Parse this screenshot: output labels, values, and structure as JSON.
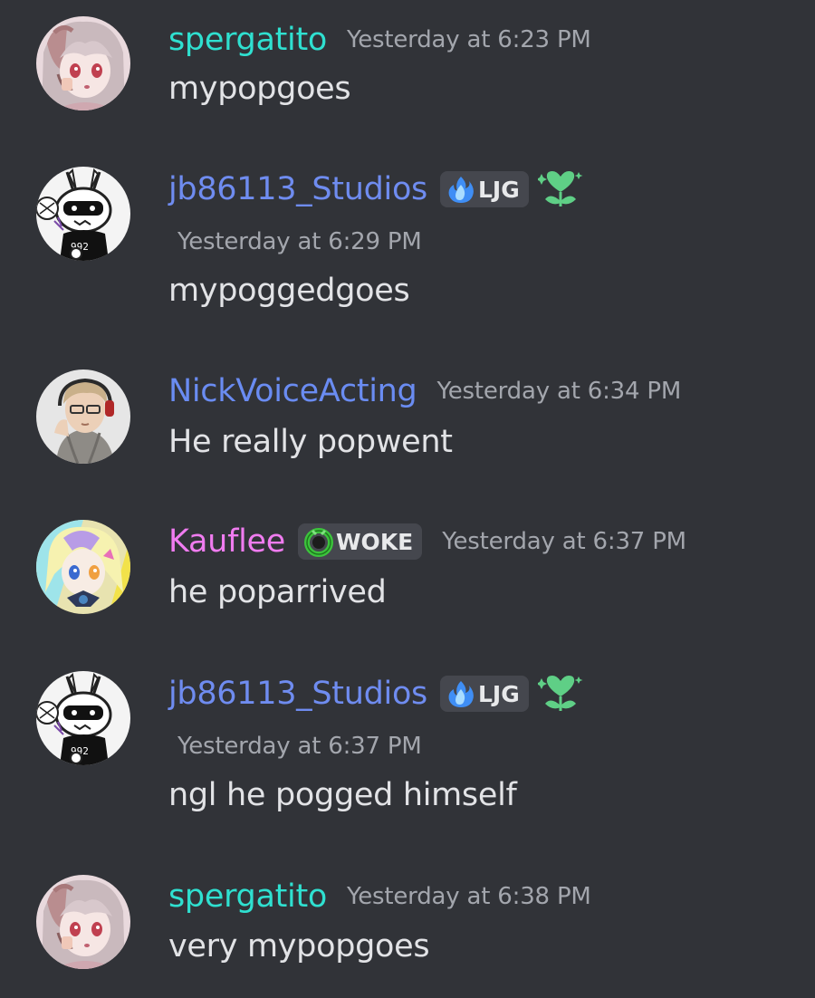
{
  "colors": {
    "background": "#313338",
    "spergatito": "#2fe0d0",
    "jb86113_Studios": "#6f8cf0",
    "NickVoiceActing": "#6a8cf2",
    "Kauflee": "#f07cf0",
    "timestamp": "#a3a6ad",
    "tag_background": "#45474e",
    "role_icon": "#5fcf86"
  },
  "messages": [
    {
      "author": "spergatito",
      "timestamp": "Yesterday at 6:23 PM",
      "content": "mypopgoes",
      "avatar_icon": "anime-girl-avatar-icon"
    },
    {
      "author": "jb86113_Studios",
      "tag": "LJG",
      "tag_icon": "blue-flame-icon",
      "role_icon": "heart-flower-icon",
      "timestamp": "Yesterday at 6:29 PM",
      "content": "mypoggedgoes",
      "avatar_icon": "sketch-character-avatar-icon"
    },
    {
      "author": "NickVoiceActing",
      "timestamp": "Yesterday at 6:34 PM",
      "content": "He really popwent",
      "avatar_icon": "headphones-character-avatar-icon"
    },
    {
      "author": "Kauflee",
      "tag": "WOKE",
      "tag_icon": "green-ring-icon",
      "timestamp": "Yesterday at 6:37 PM",
      "content": "he poparrived",
      "avatar_icon": "colorful-character-avatar-icon"
    },
    {
      "author": "jb86113_Studios",
      "tag": "LJG",
      "tag_icon": "blue-flame-icon",
      "role_icon": "heart-flower-icon",
      "timestamp": "Yesterday at 6:37 PM",
      "content": "ngl he pogged himself",
      "avatar_icon": "sketch-character-avatar-icon"
    },
    {
      "author": "spergatito",
      "timestamp": "Yesterday at 6:38 PM",
      "content": "very mypopgoes",
      "avatar_icon": "anime-girl-avatar-icon"
    }
  ]
}
